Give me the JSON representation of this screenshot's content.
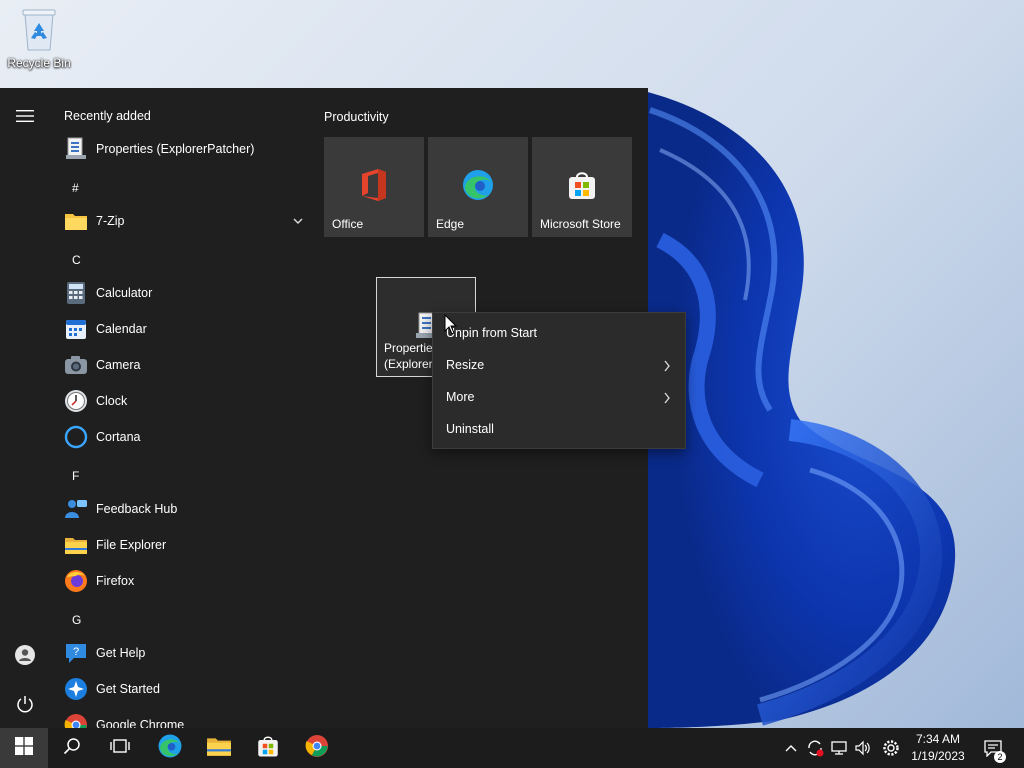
{
  "desktop": {
    "icons": [
      {
        "label": "Recycle Bin",
        "icon": "recycle-bin-icon"
      }
    ]
  },
  "start_menu": {
    "recently_added_label": "Recently added",
    "recent_items": [
      {
        "label": "Properties (ExplorerPatcher)",
        "icon": "properties-icon"
      }
    ],
    "sections": [
      {
        "letter": "#",
        "apps": [
          {
            "label": "7-Zip",
            "icon": "folder-icon",
            "expandable": true
          }
        ]
      },
      {
        "letter": "C",
        "apps": [
          {
            "label": "Calculator",
            "icon": "calculator-icon"
          },
          {
            "label": "Calendar",
            "icon": "calendar-icon"
          },
          {
            "label": "Camera",
            "icon": "camera-icon"
          },
          {
            "label": "Clock",
            "icon": "clock-icon"
          },
          {
            "label": "Cortana",
            "icon": "cortana-icon"
          }
        ]
      },
      {
        "letter": "F",
        "apps": [
          {
            "label": "Feedback Hub",
            "icon": "feedback-hub-icon"
          },
          {
            "label": "File Explorer",
            "icon": "file-explorer-icon"
          },
          {
            "label": "Firefox",
            "icon": "firefox-icon"
          }
        ]
      },
      {
        "letter": "G",
        "apps": [
          {
            "label": "Get Help",
            "icon": "get-help-icon"
          },
          {
            "label": "Get Started",
            "icon": "get-started-icon"
          },
          {
            "label": "Google Chrome",
            "icon": "chrome-icon"
          }
        ]
      }
    ],
    "tile_group": {
      "title": "Productivity",
      "tiles": [
        {
          "label": "Office",
          "icon": "office-icon"
        },
        {
          "label": "Edge",
          "icon": "edge-icon"
        },
        {
          "label": "Microsoft Store",
          "icon": "store-icon"
        }
      ],
      "selected_tile": {
        "label": "Properties\n(Explorer",
        "icon": "properties-icon"
      }
    }
  },
  "context_menu": {
    "items": [
      {
        "label": "Unpin from Start",
        "has_submenu": false
      },
      {
        "label": "Resize",
        "has_submenu": true
      },
      {
        "label": "More",
        "has_submenu": true
      },
      {
        "label": "Uninstall",
        "has_submenu": false
      }
    ]
  },
  "taskbar": {
    "pinned": [
      "start-icon",
      "search-icon",
      "task-view-icon",
      "edge-icon",
      "file-explorer-icon",
      "store-icon",
      "chrome-icon"
    ],
    "tray": [
      "chevron-up-icon",
      "update-icon",
      "network-icon",
      "volume-icon",
      "settings-icon"
    ],
    "time": "7:34 AM",
    "date": "1/19/2023",
    "notification_count": "2"
  },
  "colors": {
    "start_bg": "#1f1f1f",
    "tile_bg": "#3a3a3a",
    "context_bg": "#2b2b2b",
    "taskbar_bg": "#1c1c1c",
    "accent_blue": "#1a5fd6"
  }
}
